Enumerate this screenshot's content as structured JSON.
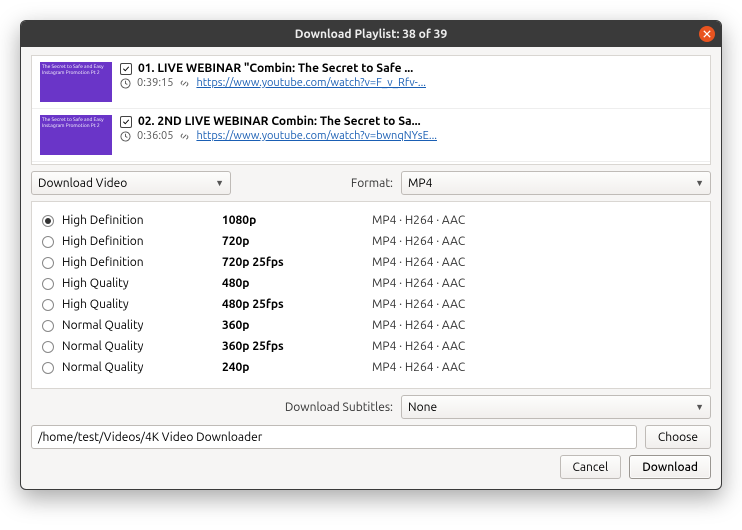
{
  "title": "Download Playlist: 38 of 39",
  "videos": [
    {
      "checked": true,
      "thumb_text": "The Secret to Safe and Easy Instagram Promotion Pt 2",
      "title": "01. LIVE WEBINAR \"Combin: The Secret to Safe ...",
      "duration": "0:39:15",
      "url": "https://www.youtube.com/watch?v=F_v_Rfv-..."
    },
    {
      "checked": true,
      "thumb_text": "The Secret to Safe and Easy Instagram Promotion Pt 2",
      "title": "02. 2ND LIVE WEBINAR Combin: The Secret to Sa...",
      "duration": "0:36:05",
      "url": "https://www.youtube.com/watch?v=bwnqNYsE..."
    }
  ],
  "action_select": "Download Video",
  "format_label": "Format:",
  "format_value": "MP4",
  "quality_options": [
    {
      "label": "High Definition",
      "res": "1080p",
      "codec": "MP4 · H264 · AAC",
      "selected": true
    },
    {
      "label": "High Definition",
      "res": "720p",
      "codec": "MP4 · H264 · AAC",
      "selected": false
    },
    {
      "label": "High Definition",
      "res": "720p 25fps",
      "codec": "MP4 · H264 · AAC",
      "selected": false
    },
    {
      "label": "High Quality",
      "res": "480p",
      "codec": "MP4 · H264 · AAC",
      "selected": false
    },
    {
      "label": "High Quality",
      "res": "480p 25fps",
      "codec": "MP4 · H264 · AAC",
      "selected": false
    },
    {
      "label": "Normal Quality",
      "res": "360p",
      "codec": "MP4 · H264 · AAC",
      "selected": false
    },
    {
      "label": "Normal Quality",
      "res": "360p 25fps",
      "codec": "MP4 · H264 · AAC",
      "selected": false
    },
    {
      "label": "Normal Quality",
      "res": "240p",
      "codec": "MP4 · H264 · AAC",
      "selected": false
    }
  ],
  "subtitles_label": "Download Subtitles:",
  "subtitles_value": "None",
  "dest_path": "/home/test/Videos/4K Video Downloader",
  "choose_label": "Choose",
  "cancel_label": "Cancel",
  "download_label": "Download"
}
